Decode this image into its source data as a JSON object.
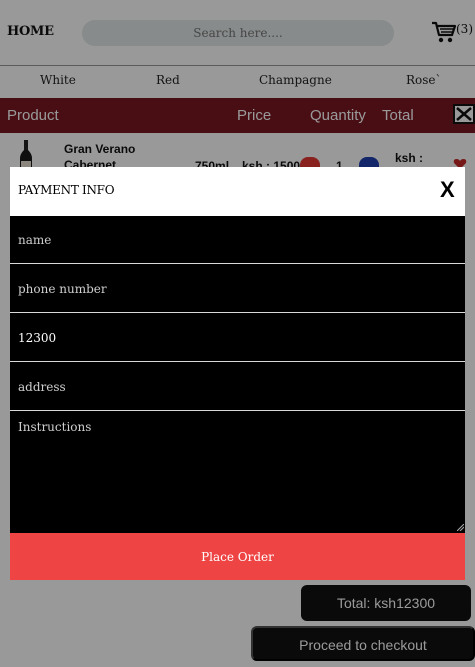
{
  "header": {
    "home_label": "HOME",
    "search_placeholder": "Search here....",
    "cart_count": "(3)"
  },
  "categories": [
    "White",
    "Red",
    "Champagne",
    "Rose`"
  ],
  "table": {
    "columns": [
      "Product",
      "Price",
      "Quantity",
      "Total"
    ],
    "rows": [
      {
        "name_line1": "Gran Verano",
        "name_line2": "Cabernet",
        "size": "750ml",
        "price": "ksh : 1500",
        "quantity": "1",
        "total": "ksh :"
      }
    ]
  },
  "summary": {
    "total_label": "Total: ksh12300",
    "checkout_label": "Proceed to checkout"
  },
  "modal": {
    "title": "PAYMENT INFO",
    "close_label": "X",
    "fields": {
      "name_placeholder": "name",
      "phone_placeholder": "phone number",
      "amount_value": "12300",
      "address_placeholder": "address",
      "instructions_placeholder": "Instructions"
    },
    "submit_label": "Place Order"
  },
  "colors": {
    "table_header": "#7a1722",
    "place_order": "#ef4444",
    "decrement_button": "#e53935",
    "increment_button": "#1e40af"
  }
}
